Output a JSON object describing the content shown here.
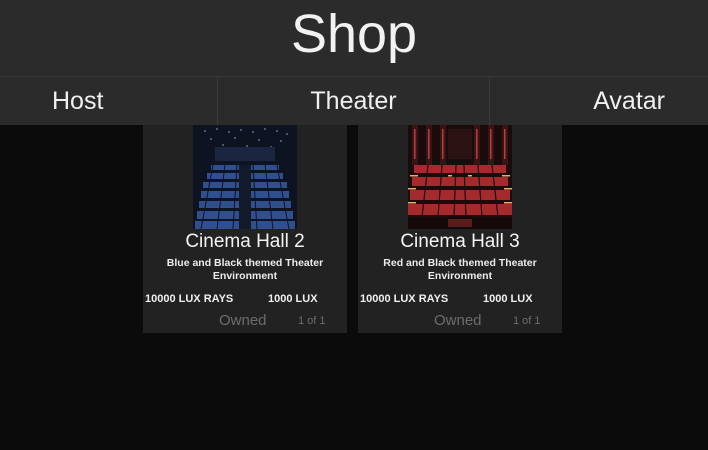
{
  "header": {
    "title": "Shop"
  },
  "tabs": [
    {
      "label": "Host"
    },
    {
      "label": "Theater"
    },
    {
      "label": "Avatar"
    }
  ],
  "items": [
    {
      "title": "Cinema Hall 2",
      "description": "Blue and Black themed Theater Environment",
      "price_rays": "10000 LUX RAYS",
      "price_lux": "1000 LUX",
      "status": "Owned",
      "count": "1 of 1",
      "theme_color": "#3a5fa8"
    },
    {
      "title": "Cinema Hall 3",
      "description": "Red and Black themed Theater Environment",
      "price_rays": "10000 LUX RAYS",
      "price_lux": "1000 LUX",
      "status": "Owned",
      "count": "1 of 1",
      "theme_color": "#b8262a"
    }
  ]
}
